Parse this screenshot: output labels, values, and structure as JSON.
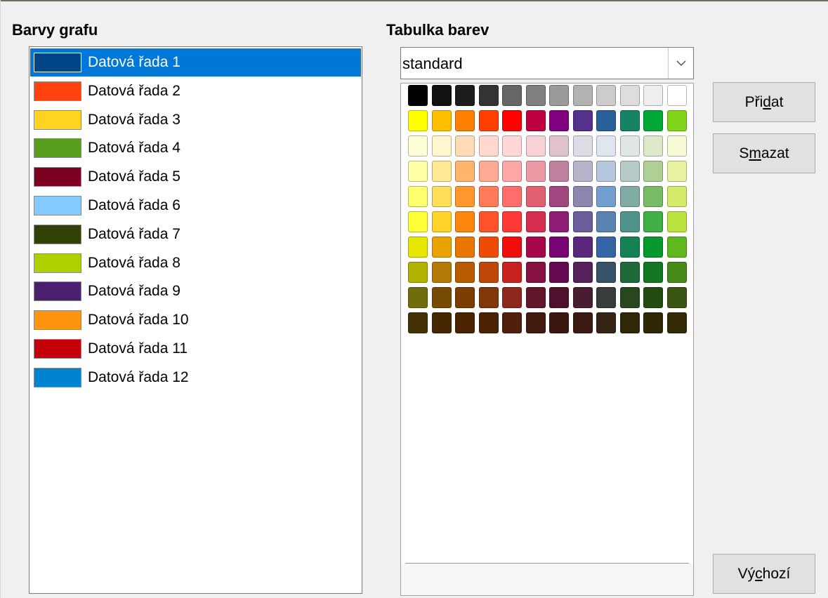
{
  "headings": {
    "chart_colors": "Barvy grafu",
    "color_table": "Tabulka barev"
  },
  "series": [
    {
      "label": "Datová řada 1",
      "color": "#004586",
      "selected": true
    },
    {
      "label": "Datová řada 2",
      "color": "#ff420e"
    },
    {
      "label": "Datová řada 3",
      "color": "#ffd320"
    },
    {
      "label": "Datová řada 4",
      "color": "#579d1c"
    },
    {
      "label": "Datová řada 5",
      "color": "#7e0021"
    },
    {
      "label": "Datová řada 6",
      "color": "#83caff"
    },
    {
      "label": "Datová řada 7",
      "color": "#314004"
    },
    {
      "label": "Datová řada 8",
      "color": "#aecf00"
    },
    {
      "label": "Datová řada 9",
      "color": "#4b1f6f"
    },
    {
      "label": "Datová řada 10",
      "color": "#ff950e"
    },
    {
      "label": "Datová řada 11",
      "color": "#c5000b"
    },
    {
      "label": "Datová řada 12",
      "color": "#0084d1"
    }
  ],
  "palette_select": {
    "value": "standard",
    "icon": "chevron-down-icon"
  },
  "palette": [
    [
      "#000000",
      "#111111",
      "#1c1c1c",
      "#333333",
      "#666666",
      "#808080",
      "#999999",
      "#b2b2b2",
      "#cccccc",
      "#dddddd",
      "#eeeeee",
      "#ffffff"
    ],
    [
      "#ffff00",
      "#ffbf00",
      "#ff8000",
      "#ff4000",
      "#ff0000",
      "#bf0041",
      "#800080",
      "#55308d",
      "#2a6099",
      "#158466",
      "#00a933",
      "#81d41a"
    ],
    [
      "#ffffd7",
      "#fff5ce",
      "#ffdbb6",
      "#ffd8ce",
      "#ffd7d7",
      "#f7d1d5",
      "#e0c2cd",
      "#dedce6",
      "#dee6ef",
      "#dee7e5",
      "#dde8cb",
      "#f6f9d4"
    ],
    [
      "#ffffa6",
      "#ffe994",
      "#ffb66c",
      "#ffaa95",
      "#ffa6a6",
      "#ec9ba4",
      "#bf819e",
      "#b7b3ca",
      "#b4c7dc",
      "#b3cac7",
      "#afd095",
      "#e8f2a1"
    ],
    [
      "#ffff6d",
      "#ffde59",
      "#ff972f",
      "#ff7b59",
      "#ff6d6d",
      "#e16173",
      "#a1467e",
      "#8e86ae",
      "#729fcf",
      "#81aca6",
      "#77bc65",
      "#d4ea6b"
    ],
    [
      "#ffff38",
      "#ffd428",
      "#ff860d",
      "#ff5429",
      "#ff3838",
      "#d62e4e",
      "#8d1d75",
      "#6b5e9b",
      "#5983b0",
      "#50938a",
      "#3faf46",
      "#bbe33d"
    ],
    [
      "#e6e600",
      "#e8a202",
      "#ea7500",
      "#ed4c05",
      "#f10d0c",
      "#a7074b",
      "#780373",
      "#5b277d",
      "#3465a4",
      "#168253",
      "#069a2e",
      "#5eb91e"
    ],
    [
      "#b2b200",
      "#b47804",
      "#b85c00",
      "#be480a",
      "#c9211e",
      "#861141",
      "#650953",
      "#55215b",
      "#355269",
      "#1e6a39",
      "#127622",
      "#468a1a"
    ],
    [
      "#706e0c",
      "#784b04",
      "#7b3d00",
      "#813709",
      "#8d281e",
      "#611729",
      "#4e102d",
      "#481d32",
      "#383d3c",
      "#28471f",
      "#224b12",
      "#395511"
    ],
    [
      "#443205",
      "#472702",
      "#492300",
      "#4b2204",
      "#50200c",
      "#41190d",
      "#3b160e",
      "#3a1a0f",
      "#362413",
      "#302709",
      "#2e2706",
      "#342a06"
    ]
  ],
  "buttons": {
    "add": {
      "pre": "Při",
      "key": "d",
      "post": "at"
    },
    "delete": {
      "pre": "S",
      "key": "m",
      "post": "azat"
    },
    "default": {
      "pre": "Vý",
      "key": "c",
      "post": "hozí"
    }
  }
}
